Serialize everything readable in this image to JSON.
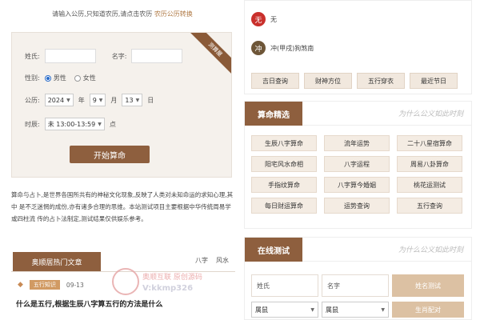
{
  "hint": {
    "text": "请输入公历,只知道农历,请点击农历",
    "link": "农历公历转换"
  },
  "form": {
    "ribbon": "测算屋",
    "name_label": "姓氏:",
    "given_label": "名字:",
    "gender_label": "性别:",
    "gender_male": "男性",
    "gender_female": "女性",
    "solar_label": "公历:",
    "year": "2024",
    "year_unit": "年",
    "month": "9",
    "month_unit": "月",
    "day": "13",
    "day_unit": "日",
    "time_label": "时辰:",
    "time": "未 13:00-13:59",
    "time_unit": "点",
    "submit": "开始算命"
  },
  "intro": "算命与占卜,是世界各国所共有的神秘文化现象,反映了人类对未知命运的求知心理,其中 是不乏迷惘的成份,亦有诸多合理的思维。本站测试项目主要根据中华传统周易学或四柱流 传的占卜法制定,测试结果仅供娱乐参考。",
  "hot": {
    "title": "奥顺居热门文章",
    "tabs": [
      "八字",
      "风水"
    ]
  },
  "news": {
    "tag": "五行知识",
    "date": "09-13",
    "title": "什么是五行,根据生辰八字算五行的方法是什么"
  },
  "watermark": {
    "line1": "奥顺互联 原创源码",
    "line2": "V:kkmp326"
  },
  "info": {
    "row1_icon": "无",
    "row1_text": "无",
    "row2_icon": "冲",
    "row2_text": "冲(甲戌)狗煞南",
    "quick": [
      "吉日查询",
      "财神方位",
      "五行穿衣",
      "最近节日"
    ]
  },
  "suanming": {
    "title": "算命精选",
    "callig": "为什么公义如此时刻",
    "items": [
      "生辰八字算命",
      "流年运势",
      "二十八星宿算命",
      "阳宅风水命相",
      "八字运程",
      "周易八卦算命",
      "手指纹算命",
      "八字算今婚姻",
      "桃花运测试",
      "每日财运算命",
      "运势查询",
      "五行查询"
    ]
  },
  "online": {
    "title": "在线测试",
    "callig": "为什么公义如此时刻",
    "surname": "姓氏",
    "given": "名字",
    "name_test": "姓名测试",
    "sel1": "属鼠",
    "sel2": "属鼠",
    "pair": "生肖配对"
  }
}
